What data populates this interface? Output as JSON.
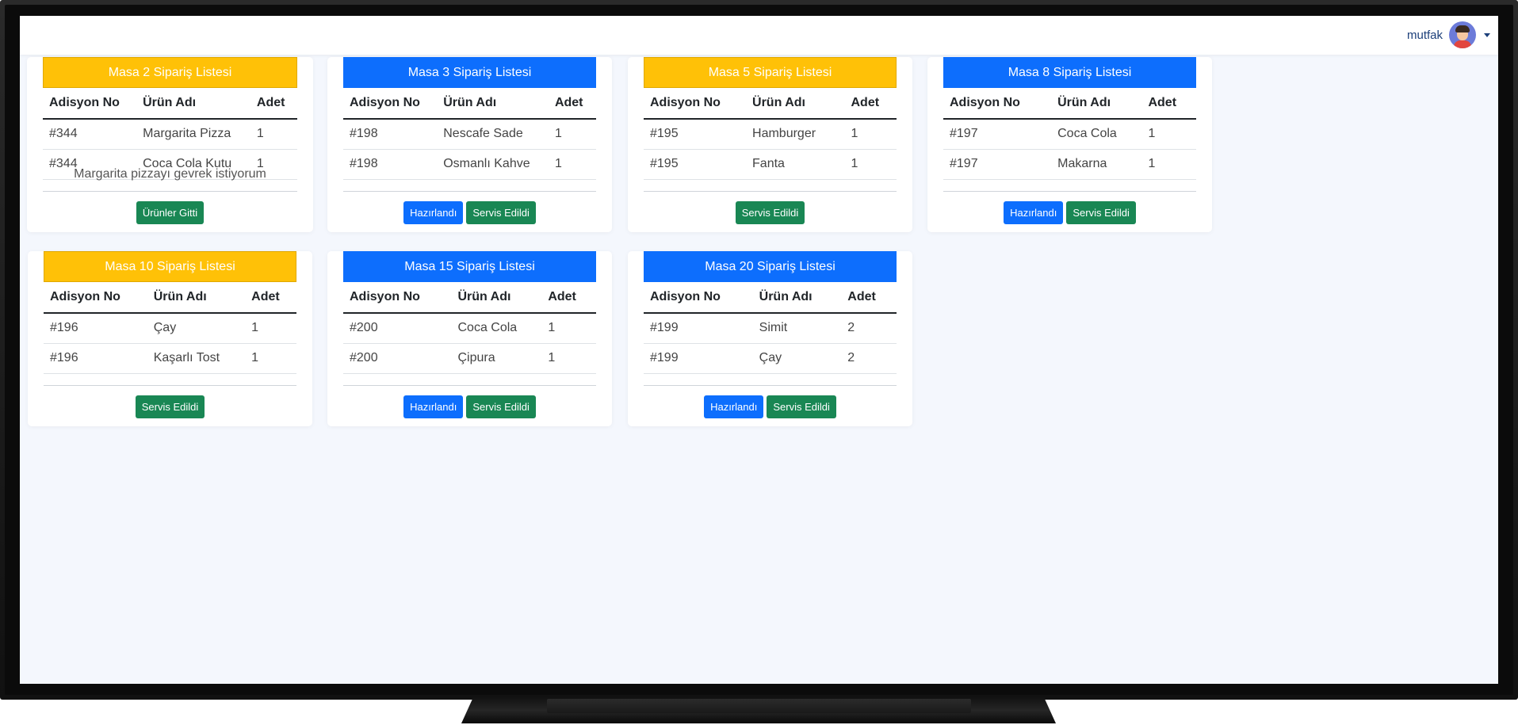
{
  "user": {
    "name": "mutfak",
    "avatar_icon": "user-avatar-icon",
    "dropdown_icon": "caret-down-icon"
  },
  "table_headers": {
    "order_no": "Adisyon No",
    "product": "Ürün Adı",
    "qty": "Adet"
  },
  "colors": {
    "yellow": "#ffc107",
    "blue": "#0d6efd",
    "success": "#198754",
    "background": "#f4f7fd"
  },
  "cards": [
    {
      "title": "Masa 2 Sipariş Listesi",
      "header_color": "yellow",
      "rows": [
        {
          "order_no": "#344",
          "product": "Margarita Pizza",
          "qty": "1"
        },
        {
          "order_no": "#344",
          "product": "Coca Cola Kutu",
          "qty": "1"
        }
      ],
      "note": "Margarita pizzayı gevrek istiyorum",
      "buttons": [
        {
          "label": "Ürünler Gitti",
          "style": "success"
        }
      ]
    },
    {
      "title": "Masa 3 Sipariş Listesi",
      "header_color": "blue",
      "rows": [
        {
          "order_no": "#198",
          "product": "Nescafe Sade",
          "qty": "1"
        },
        {
          "order_no": "#198",
          "product": "Osmanlı Kahve",
          "qty": "1"
        }
      ],
      "note": "",
      "buttons": [
        {
          "label": "Hazırlandı",
          "style": "primary"
        },
        {
          "label": "Servis Edildi",
          "style": "success"
        }
      ]
    },
    {
      "title": "Masa 5 Sipariş Listesi",
      "header_color": "yellow",
      "rows": [
        {
          "order_no": "#195",
          "product": "Hamburger",
          "qty": "1"
        },
        {
          "order_no": "#195",
          "product": "Fanta",
          "qty": "1"
        }
      ],
      "note": "",
      "buttons": [
        {
          "label": "Servis Edildi",
          "style": "success"
        }
      ]
    },
    {
      "title": "Masa 8 Sipariş Listesi",
      "header_color": "blue",
      "rows": [
        {
          "order_no": "#197",
          "product": "Coca Cola",
          "qty": "1"
        },
        {
          "order_no": "#197",
          "product": "Makarna",
          "qty": "1"
        }
      ],
      "note": "",
      "buttons": [
        {
          "label": "Hazırlandı",
          "style": "primary"
        },
        {
          "label": "Servis Edildi",
          "style": "success"
        }
      ]
    },
    {
      "title": "Masa 10 Sipariş Listesi",
      "header_color": "yellow",
      "rows": [
        {
          "order_no": "#196",
          "product": "Çay",
          "qty": "1"
        },
        {
          "order_no": "#196",
          "product": "Kaşarlı Tost",
          "qty": "1"
        }
      ],
      "note": "",
      "buttons": [
        {
          "label": "Servis Edildi",
          "style": "success"
        }
      ]
    },
    {
      "title": "Masa 15 Sipariş Listesi",
      "header_color": "blue",
      "rows": [
        {
          "order_no": "#200",
          "product": "Coca Cola",
          "qty": "1"
        },
        {
          "order_no": "#200",
          "product": "Çipura",
          "qty": "1"
        }
      ],
      "note": "",
      "buttons": [
        {
          "label": "Hazırlandı",
          "style": "primary"
        },
        {
          "label": "Servis Edildi",
          "style": "success"
        }
      ]
    },
    {
      "title": "Masa 20 Sipariş Listesi",
      "header_color": "blue",
      "rows": [
        {
          "order_no": "#199",
          "product": "Simit",
          "qty": "2"
        },
        {
          "order_no": "#199",
          "product": "Çay",
          "qty": "2"
        }
      ],
      "note": "",
      "buttons": [
        {
          "label": "Hazırlandı",
          "style": "primary"
        },
        {
          "label": "Servis Edildi",
          "style": "success"
        }
      ]
    }
  ]
}
